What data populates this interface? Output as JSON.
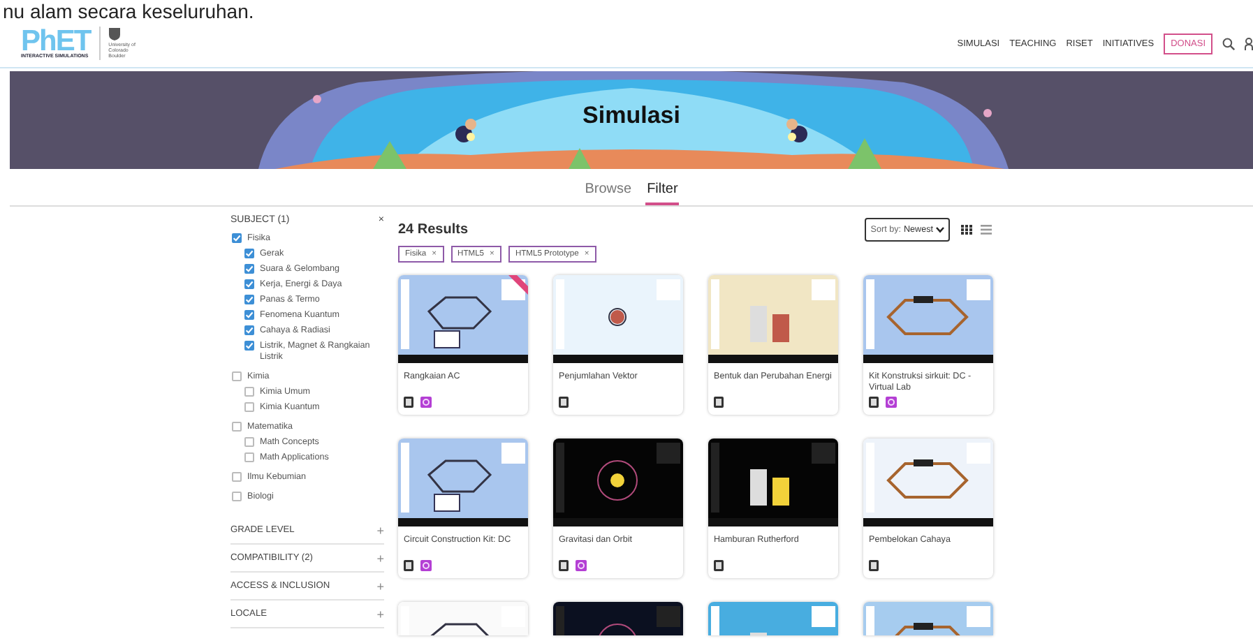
{
  "caption": "nu alam secara keseluruhan.",
  "header": {
    "logo": {
      "name": "PhET",
      "tagline": "INTERACTIVE SIMULATIONS",
      "partner": "University of Colorado Boulder"
    },
    "nav": [
      {
        "label": "SIMULASI",
        "kind": "link"
      },
      {
        "label": "TEACHING",
        "kind": "link"
      },
      {
        "label": "RISET",
        "kind": "link"
      },
      {
        "label": "INITIATIVES",
        "kind": "link"
      },
      {
        "label": "DONASI",
        "kind": "button"
      }
    ]
  },
  "banner": {
    "title": "Simulasi"
  },
  "tabs": [
    {
      "label": "Browse",
      "selected": false
    },
    {
      "label": "Filter",
      "selected": true
    }
  ],
  "sidebar": {
    "subject": {
      "title": "SUBJECT (1)",
      "clear": "×",
      "items": [
        {
          "label": "Fisika",
          "checked": true,
          "children": [
            {
              "label": "Gerak",
              "checked": true
            },
            {
              "label": "Suara & Gelombang",
              "checked": true
            },
            {
              "label": "Kerja, Energi & Daya",
              "checked": true
            },
            {
              "label": "Panas & Termo",
              "checked": true
            },
            {
              "label": "Fenomena Kuantum",
              "checked": true
            },
            {
              "label": "Cahaya & Radiasi",
              "checked": true
            },
            {
              "label": "Listrik, Magnet & Rangkaian Listrik",
              "checked": true
            }
          ]
        },
        {
          "label": "Kimia",
          "checked": false,
          "children": [
            {
              "label": "Kimia Umum",
              "checked": false
            },
            {
              "label": "Kimia Kuantum",
              "checked": false
            }
          ]
        },
        {
          "label": "Matematika",
          "checked": false,
          "children": [
            {
              "label": "Math Concepts",
              "checked": false
            },
            {
              "label": "Math Applications",
              "checked": false
            }
          ]
        },
        {
          "label": "Ilmu Kebumian",
          "checked": false
        },
        {
          "label": "Biologi",
          "checked": false
        }
      ]
    },
    "sections": [
      {
        "title": "GRADE LEVEL",
        "toggle": "+"
      },
      {
        "title": "COMPATIBILITY (2)",
        "toggle": "+"
      },
      {
        "title": "ACCESS & INCLUSION",
        "toggle": "+"
      },
      {
        "title": "LOCALE",
        "toggle": "+"
      }
    ]
  },
  "results": {
    "count": "24 Results",
    "sort": {
      "label": "Sort by:",
      "value": "Newest"
    },
    "views": [
      {
        "kind": "grid",
        "selected": true
      },
      {
        "kind": "list",
        "selected": false
      }
    ],
    "chips": [
      {
        "label": "Fisika",
        "remove": "×"
      },
      {
        "label": "HTML5",
        "remove": "×"
      },
      {
        "label": "HTML5 Prototype",
        "remove": "×"
      }
    ],
    "cards": [
      {
        "title": "Rangkaian AC",
        "new": true,
        "badges": [
          {
            "kind": "html5"
          },
          {
            "kind": "prototype"
          }
        ]
      },
      {
        "title": "Penjumlahan Vektor",
        "new": false,
        "badges": [
          {
            "kind": "html5"
          }
        ]
      },
      {
        "title": "Bentuk dan Perubahan Energi",
        "new": false,
        "badges": [
          {
            "kind": "html5"
          }
        ]
      },
      {
        "title": "Kit Konstruksi sirkuit: DC - Virtual Lab",
        "new": false,
        "badges": [
          {
            "kind": "html5"
          },
          {
            "kind": "prototype"
          }
        ]
      },
      {
        "title": "Circuit Construction Kit: DC",
        "new": false,
        "badges": [
          {
            "kind": "html5"
          },
          {
            "kind": "prototype"
          }
        ]
      },
      {
        "title": "Gravitasi dan Orbit",
        "new": false,
        "badges": [
          {
            "kind": "html5"
          },
          {
            "kind": "prototype"
          }
        ]
      },
      {
        "title": "Hamburan Rutherford",
        "new": false,
        "badges": [
          {
            "kind": "html5"
          }
        ]
      },
      {
        "title": "Pembelokan Cahaya",
        "new": false,
        "badges": [
          {
            "kind": "html5"
          }
        ]
      },
      {
        "kind": "picture"
      },
      {
        "kind": "picture"
      },
      {
        "kind": "picture"
      },
      {
        "kind": "picture"
      }
    ]
  }
}
